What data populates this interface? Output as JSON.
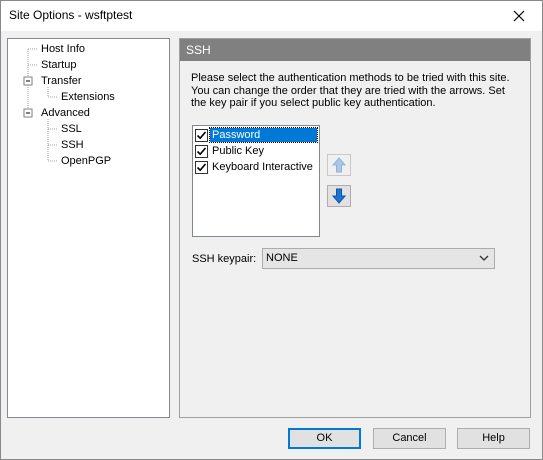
{
  "window": {
    "title": "Site Options - wsftptest"
  },
  "tree": {
    "items": [
      {
        "label": "Host Info"
      },
      {
        "label": "Startup"
      },
      {
        "label": "Transfer"
      },
      {
        "label": "Extensions"
      },
      {
        "label": "Advanced"
      },
      {
        "label": "SSL"
      },
      {
        "label": "SSH"
      },
      {
        "label": "OpenPGP"
      }
    ]
  },
  "panel": {
    "header": "SSH",
    "instructions": "Please select the authentication methods to be tried with this site. You can change the order that they are tried with the arrows. Set the key pair if you select public key authentication.",
    "methods": [
      {
        "label": "Password",
        "checked": true,
        "selected": true
      },
      {
        "label": "Public Key",
        "checked": true,
        "selected": false
      },
      {
        "label": "Keyboard Interactive",
        "checked": true,
        "selected": false
      }
    ],
    "keypair_label": "SSH keypair:",
    "keypair_value": "NONE"
  },
  "buttons": {
    "ok": "OK",
    "cancel": "Cancel",
    "help": "Help"
  },
  "colors": {
    "selection": "#0078d7",
    "header_bg": "#808080",
    "arrow_blue": "#1e74d0"
  }
}
